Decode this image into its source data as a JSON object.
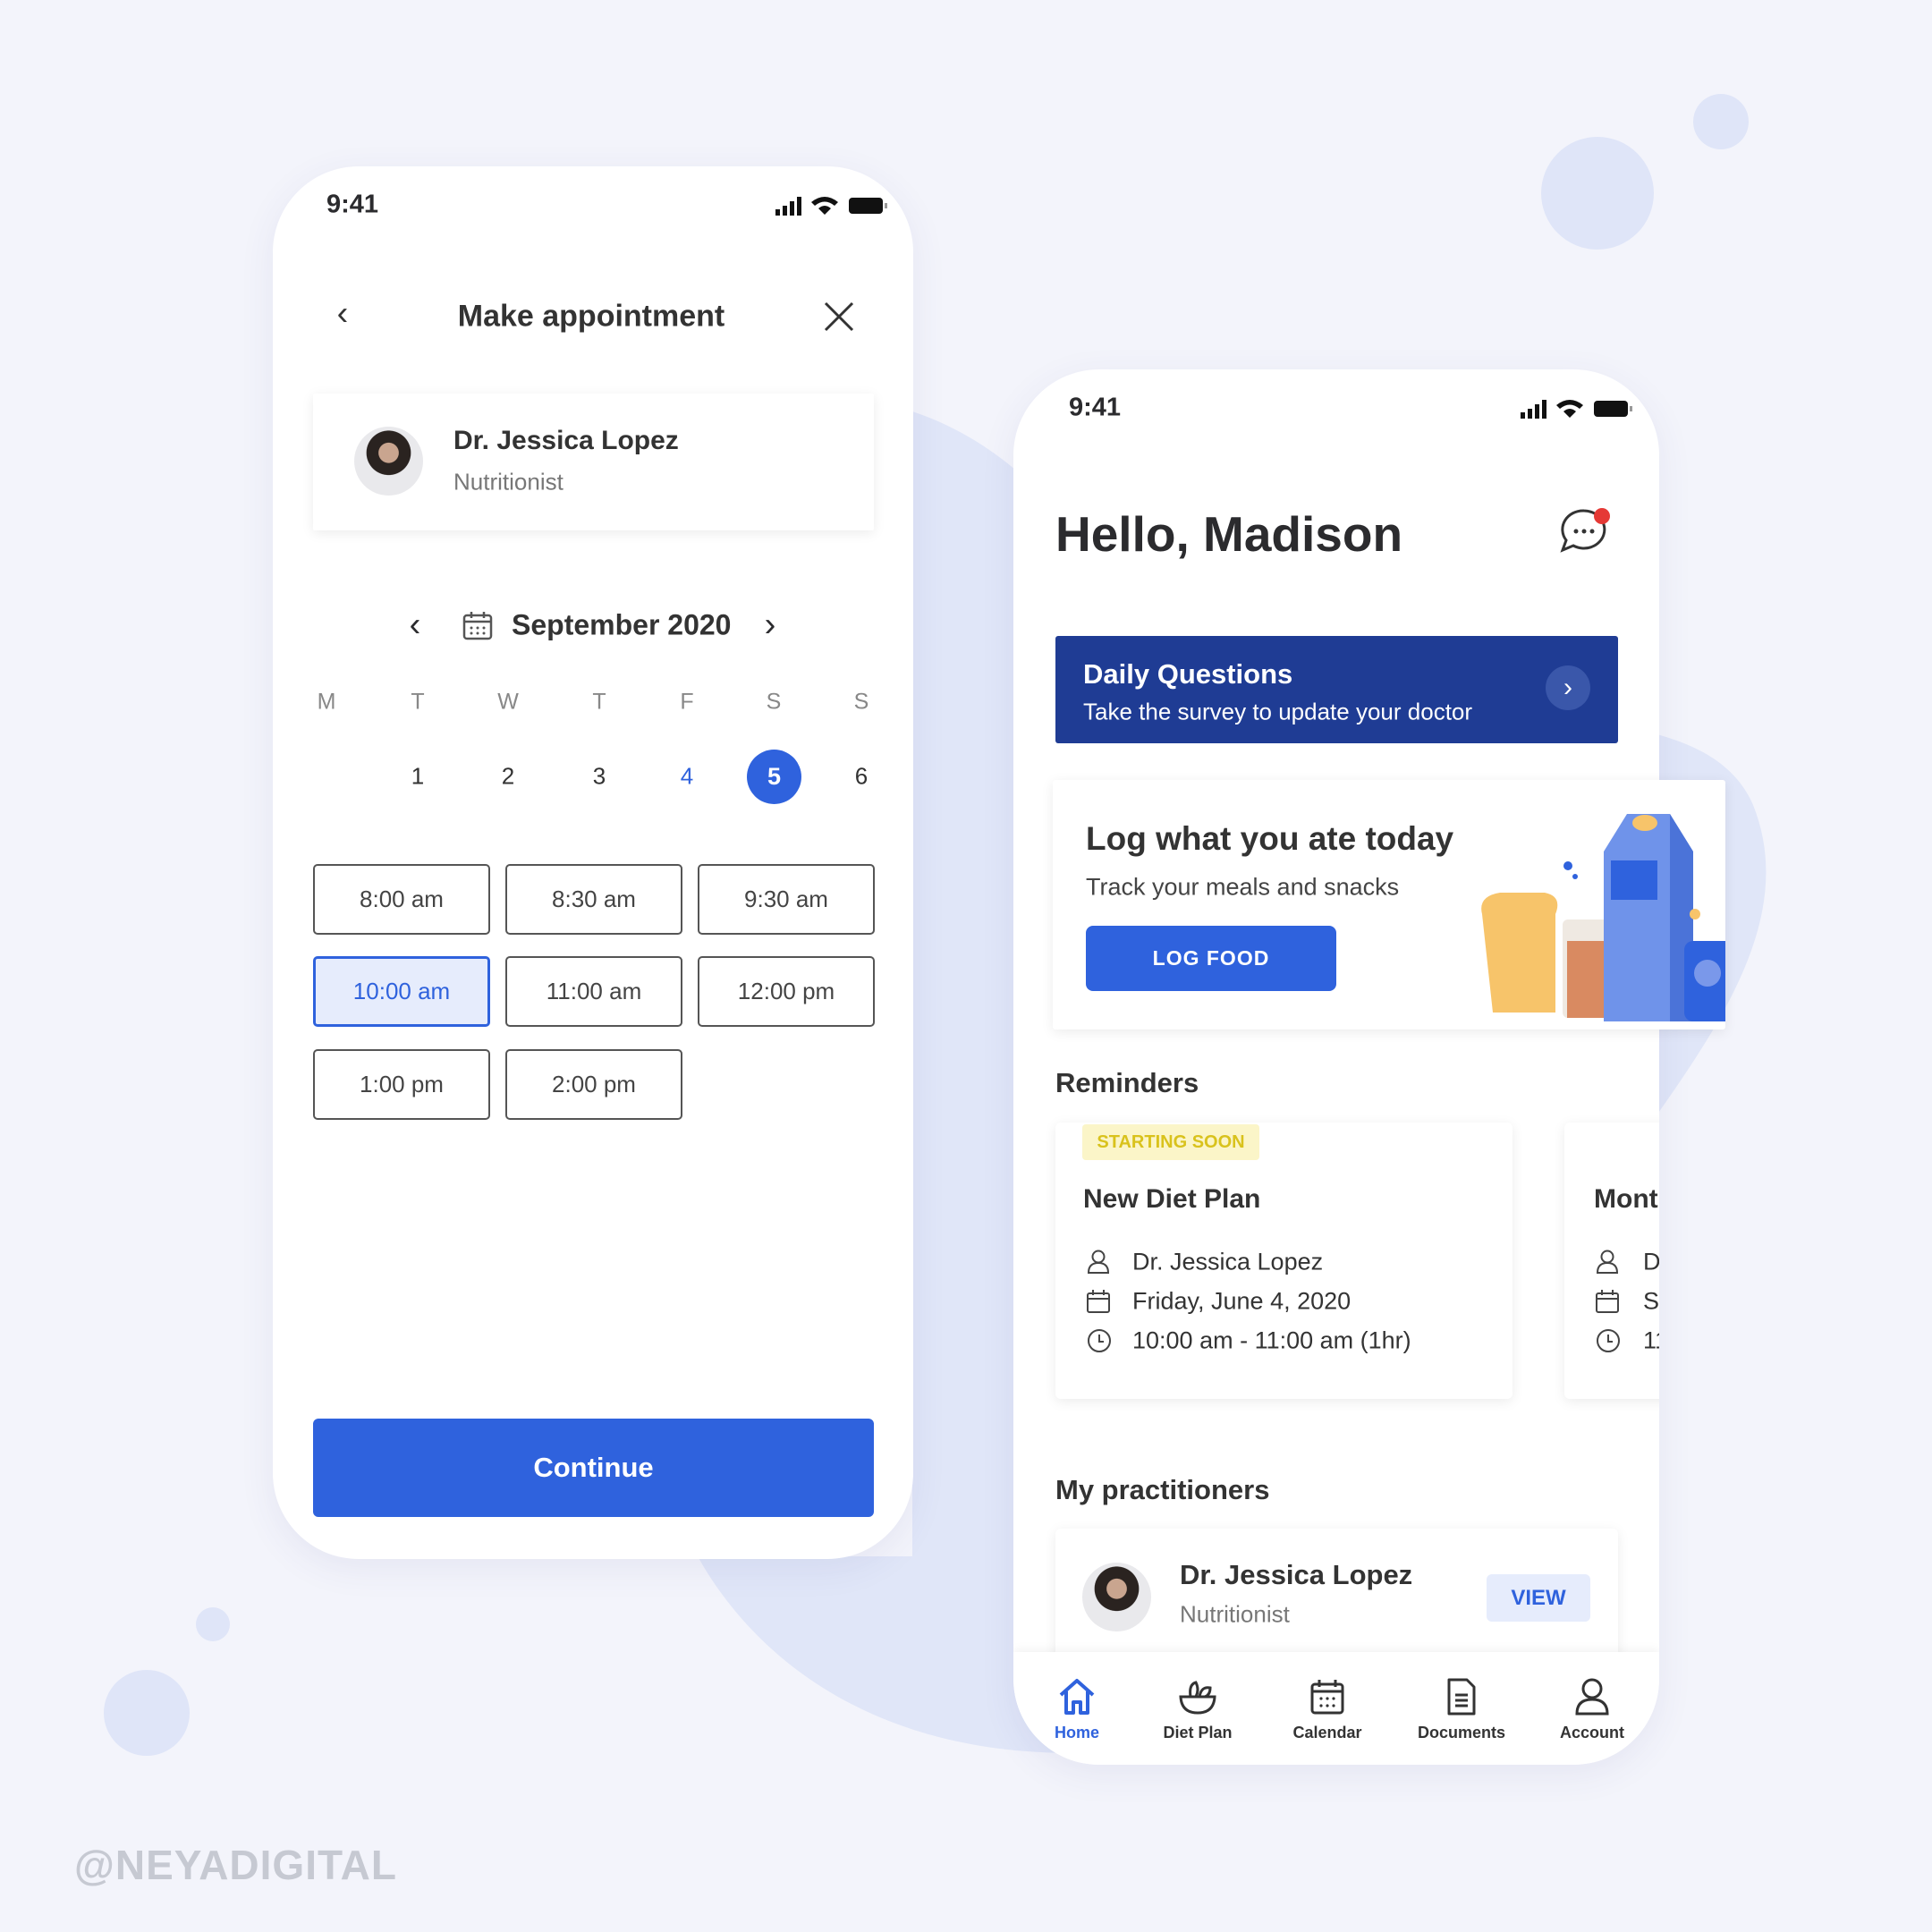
{
  "watermark": "@NEYADIGITAL",
  "colors": {
    "accent": "#2f62dd",
    "banner": "#1f3c94",
    "badge_bg": "#fbf5c8",
    "badge_text": "#d9c21c",
    "notification": "#e53935"
  },
  "appointment": {
    "status_time": "9:41",
    "title": "Make appointment",
    "doctor": {
      "name": "Dr. Jessica Lopez",
      "role": "Nutritionist"
    },
    "month": "September 2020",
    "weekdays": [
      "M",
      "T",
      "W",
      "T",
      "F",
      "S",
      "S"
    ],
    "dates": [
      "1",
      "2",
      "3",
      "4",
      "5",
      "6"
    ],
    "selected_date": "5",
    "slots": [
      "8:00 am",
      "8:30 am",
      "9:30 am",
      "10:00 am",
      "11:00 am",
      "12:00 pm",
      "1:00 pm",
      "2:00 pm"
    ],
    "selected_slot": "10:00 am",
    "continue_label": "Continue"
  },
  "home": {
    "status_time": "9:41",
    "greeting": "Hello, Madison",
    "banner": {
      "title": "Daily Questions",
      "subtitle": "Take the survey to update your doctor"
    },
    "log": {
      "title": "Log what you ate today",
      "subtitle": "Track your meals and snacks",
      "button": "LOG FOOD"
    },
    "reminders_title": "Reminders",
    "reminders": [
      {
        "badge": "STARTING SOON",
        "title": "New Diet Plan",
        "doctor": "Dr. Jessica Lopez",
        "date": "Friday, June 4, 2020",
        "time": "10:00 am - 11:00 am (1hr)"
      },
      {
        "title": "Mont",
        "doctor": "D",
        "date": "S",
        "time": "11"
      }
    ],
    "practitioners_title": "My practitioners",
    "practitioner": {
      "name": "Dr. Jessica Lopez",
      "role": "Nutritionist",
      "button": "VIEW"
    },
    "nav": [
      {
        "label": "Home",
        "icon": "home-icon",
        "active": true
      },
      {
        "label": "Diet Plan",
        "icon": "salad-bowl-icon"
      },
      {
        "label": "Calendar",
        "icon": "calendar-icon"
      },
      {
        "label": "Documents",
        "icon": "document-icon"
      },
      {
        "label": "Account",
        "icon": "user-icon"
      }
    ]
  }
}
